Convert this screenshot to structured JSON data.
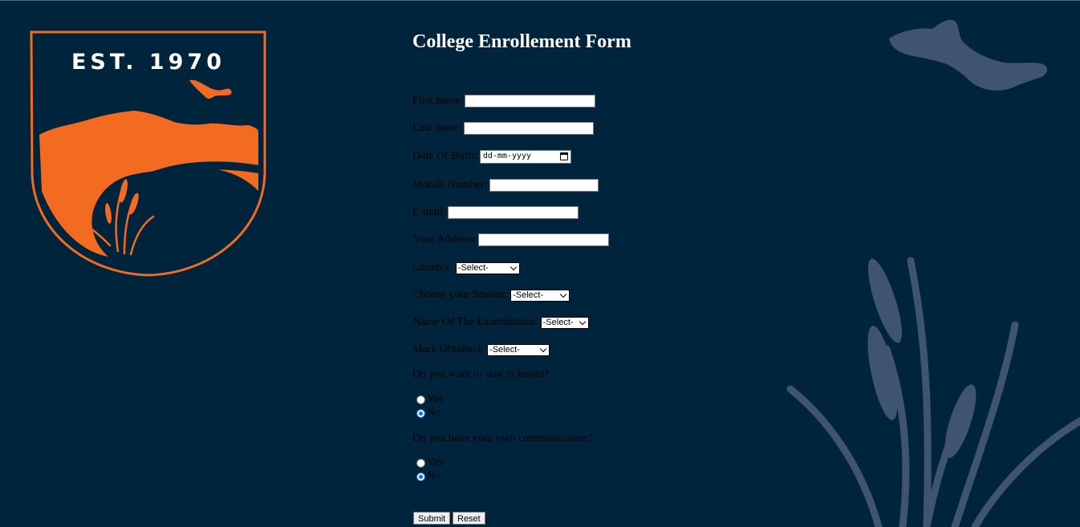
{
  "crest": {
    "est_text": "EST. 1970",
    "colors": {
      "accent": "#f26b21",
      "background": "#00243c"
    }
  },
  "form": {
    "title": "College Enrollement Form",
    "fields": {
      "first_name": {
        "label": "First name:",
        "value": ""
      },
      "last_name": {
        "label": "Last name:",
        "value": ""
      },
      "dob": {
        "label": "Date Of Birth:",
        "placeholder": "dd-mm-yyyy",
        "icon": "calendar-icon"
      },
      "mobile": {
        "label": "Mobile Number:",
        "value": ""
      },
      "email": {
        "label": "E-mail:",
        "value": ""
      },
      "address": {
        "label": "Your Address:",
        "value": ""
      },
      "country": {
        "label": "Country:",
        "selected": "-Select-"
      },
      "stream": {
        "label": "Choose your Stream:",
        "selected": "-Select-"
      },
      "exam": {
        "label": "Name Of The Examination:",
        "selected": "-Select-"
      },
      "marks": {
        "label": "Mark Obtained:",
        "selected": "-Select-"
      }
    },
    "hostel": {
      "question": "Do you want to stay in hostel?",
      "options": [
        {
          "label": "Yes",
          "checked": false
        },
        {
          "label": "No",
          "checked": true
        }
      ]
    },
    "communication": {
      "question": "Do you have your own communication?",
      "options": [
        {
          "label": "Yes",
          "checked": false
        },
        {
          "label": "No",
          "checked": true
        }
      ]
    },
    "buttons": {
      "submit": "Submit",
      "reset": "Reset"
    }
  }
}
